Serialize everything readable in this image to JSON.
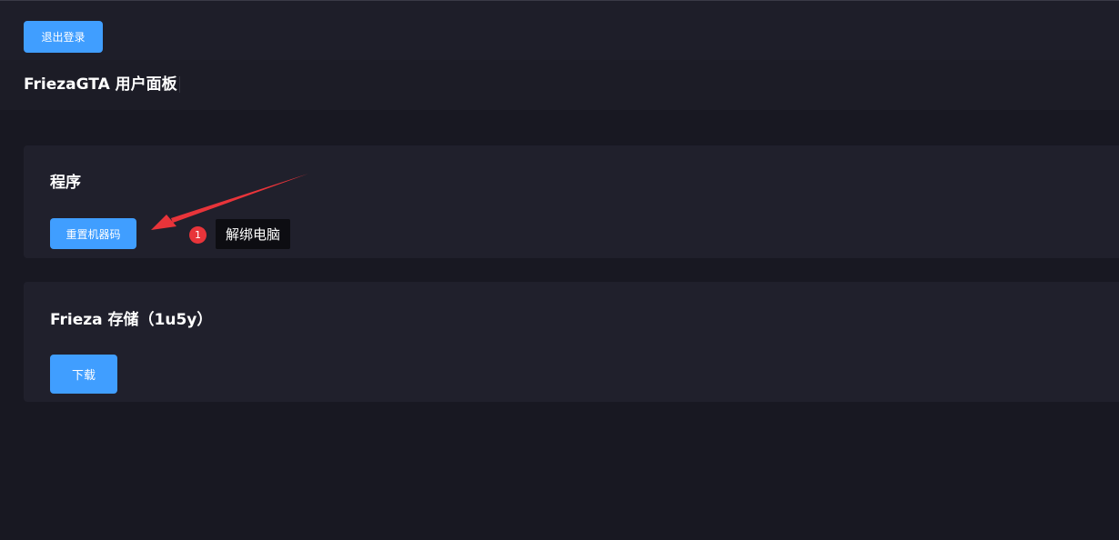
{
  "topbar": {
    "logout_label": "退出登录"
  },
  "header": {
    "title": "FriezaGTA 用户面板"
  },
  "program_card": {
    "title": "程序",
    "reset_button_label": "重置机器码"
  },
  "storage_card": {
    "title": "Frieza 存储（1u5y）",
    "download_button_label": "下载"
  },
  "annotation": {
    "step_number": "1",
    "label": "解绑电脑"
  },
  "colors": {
    "accent": "#409eff",
    "annotation_red": "#e8343a",
    "background": "#181822",
    "card": "#20202c"
  }
}
